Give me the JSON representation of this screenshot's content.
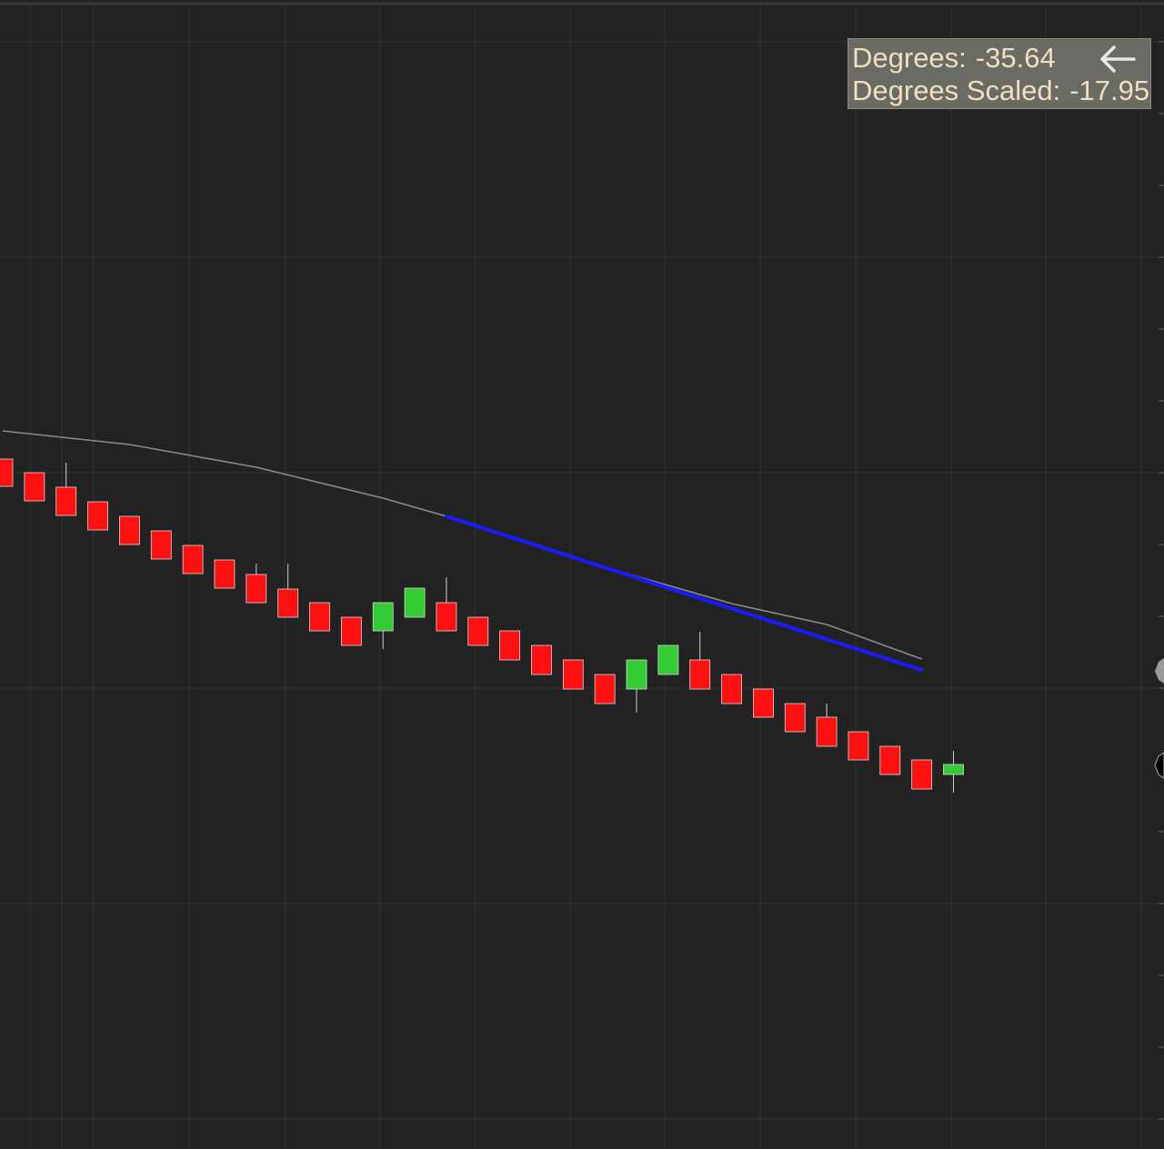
{
  "readout": {
    "degrees_label": "Degrees:",
    "degrees_value": "-35.64",
    "scaled_label": "Degrees Scaled:",
    "scaled_value": "-17.95",
    "back_icon": "arrow-left-icon"
  },
  "colors": {
    "background": "#222222",
    "grid": "#333333",
    "up": "#33cc33",
    "down": "#ff1010",
    "wick": "#cfcfcf",
    "moving_average": "#8c8c8c",
    "trend_line": "#1a1aff"
  },
  "chart_data": {
    "type": "candlestick",
    "title": "",
    "xlabel": "",
    "ylabel": "",
    "x": [
      1,
      2,
      3,
      4,
      5,
      6,
      7,
      8,
      9,
      10,
      11,
      12,
      13,
      14,
      15,
      16,
      17,
      18,
      19,
      20,
      21,
      22,
      23,
      24,
      25,
      26,
      27,
      28,
      29,
      30
    ],
    "ylim": [
      -810,
      0
    ],
    "candles": [
      {
        "x": 1,
        "dir": "down",
        "open": -505,
        "close": -535
      },
      {
        "x": 2,
        "dir": "down",
        "open": -520,
        "close": -551
      },
      {
        "x": 3,
        "dir": "down",
        "open": -536,
        "close": -567,
        "high": -509
      },
      {
        "x": 4,
        "dir": "down",
        "open": -552,
        "close": -583
      },
      {
        "x": 5,
        "dir": "down",
        "open": -568,
        "close": -599
      },
      {
        "x": 6,
        "dir": "down",
        "open": -584,
        "close": -615
      },
      {
        "x": 7,
        "dir": "down",
        "open": -600,
        "close": -631
      },
      {
        "x": 8,
        "dir": "down",
        "open": -616,
        "close": -647
      },
      {
        "x": 9,
        "dir": "down",
        "open": -632,
        "close": -663,
        "high": -620
      },
      {
        "x": 10,
        "dir": "down",
        "open": -648,
        "close": -679,
        "high": -620
      },
      {
        "x": 11,
        "dir": "down",
        "open": -663,
        "close": -694
      },
      {
        "x": 12,
        "dir": "down",
        "open": -679,
        "close": -710
      },
      {
        "x": 13,
        "dir": "up",
        "open": -694,
        "close": -663,
        "low": -714
      },
      {
        "x": 14,
        "dir": "up",
        "open": -679,
        "close": -647
      },
      {
        "x": 15,
        "dir": "down",
        "open": -663,
        "close": -694,
        "high": -635
      },
      {
        "x": 16,
        "dir": "down",
        "open": -679,
        "close": -710
      },
      {
        "x": 17,
        "dir": "down",
        "open": -694,
        "close": -726
      },
      {
        "x": 18,
        "dir": "down",
        "open": -710,
        "close": -742
      },
      {
        "x": 19,
        "dir": "down",
        "open": -726,
        "close": -758
      },
      {
        "x": 20,
        "dir": "down",
        "open": -742,
        "close": -774
      },
      {
        "x": 21,
        "dir": "up",
        "open": -758,
        "close": -726,
        "low": -784
      },
      {
        "x": 22,
        "dir": "up",
        "open": -742,
        "close": -710
      },
      {
        "x": 23,
        "dir": "down",
        "open": -726,
        "close": -758,
        "high": -695
      },
      {
        "x": 24,
        "dir": "down",
        "open": -742,
        "close": -774
      },
      {
        "x": 25,
        "dir": "down",
        "open": -758,
        "close": -789
      },
      {
        "x": 26,
        "dir": "down",
        "open": -774,
        "close": -805
      },
      {
        "x": 27,
        "dir": "down",
        "open": -789,
        "close": -821,
        "high": -774
      },
      {
        "x": 28,
        "dir": "down",
        "open": -805,
        "close": -836
      },
      {
        "x": 29,
        "dir": "down",
        "open": -821,
        "close": -852
      },
      {
        "x": 30,
        "dir": "down",
        "open": -836,
        "close": -868
      },
      {
        "x": 31,
        "dir": "up",
        "open": -852,
        "close": -841,
        "high": -826,
        "low": -872
      }
    ],
    "moving_average": {
      "x": [
        1,
        5,
        9,
        13,
        15,
        18,
        21,
        24,
        27,
        30
      ],
      "values": [
        -474,
        -489,
        -514,
        -548,
        -568,
        -603,
        -634,
        -664,
        -687,
        -725
      ]
    },
    "trend_line": {
      "x": [
        15,
        30
      ],
      "values": [
        -568,
        -737
      ]
    },
    "grid": true,
    "legend": "none"
  }
}
